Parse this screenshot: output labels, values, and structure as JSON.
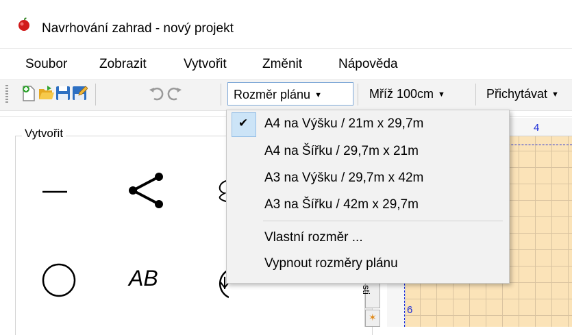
{
  "window": {
    "title": "Navrhování zahrad - nový projekt"
  },
  "menubar": {
    "items": [
      "Soubor",
      "Zobrazit",
      "Vytvořit",
      "Změnit",
      "Nápověda"
    ]
  },
  "toolbar": {
    "plan_size_label": "Rozměr plánu",
    "grid_label": "Mříž 100cm",
    "snap_label": "Přichytávat",
    "icons": [
      "new-file-icon",
      "open-folder-icon",
      "save-icon",
      "edit-icon",
      "undo-icon",
      "redo-icon"
    ]
  },
  "panel": {
    "title": "Vytvořit",
    "tools": [
      "line-tool-icon",
      "polyline-tool-icon",
      "circle-tool-icon",
      "text-tool-icon",
      "plant-tool-icon"
    ],
    "text_tool_label": "AB"
  },
  "dropdown": {
    "items": [
      {
        "label": "A4 na Výšku / 21m x 29,7m",
        "checked": true
      },
      {
        "label": "A4 na Šířku / 29,7m x 21m",
        "checked": false
      },
      {
        "label": "A3 na Výšku / 29,7m x 42m",
        "checked": false
      },
      {
        "label": "A3 na Šířku / 42m x 29,7m",
        "checked": false
      }
    ],
    "extra_items": [
      "Vlastní rozměr ...",
      "Vypnout rozměry plánu"
    ],
    "check_mark": "✔"
  },
  "canvas": {
    "ruler_top_number": "4",
    "ruler_left_number": "6",
    "side_tab_label": "sti",
    "grid_color": "#fbe3b8",
    "border_color": "#1a2bd8"
  },
  "colors": {
    "accent": "#cce4f7"
  }
}
